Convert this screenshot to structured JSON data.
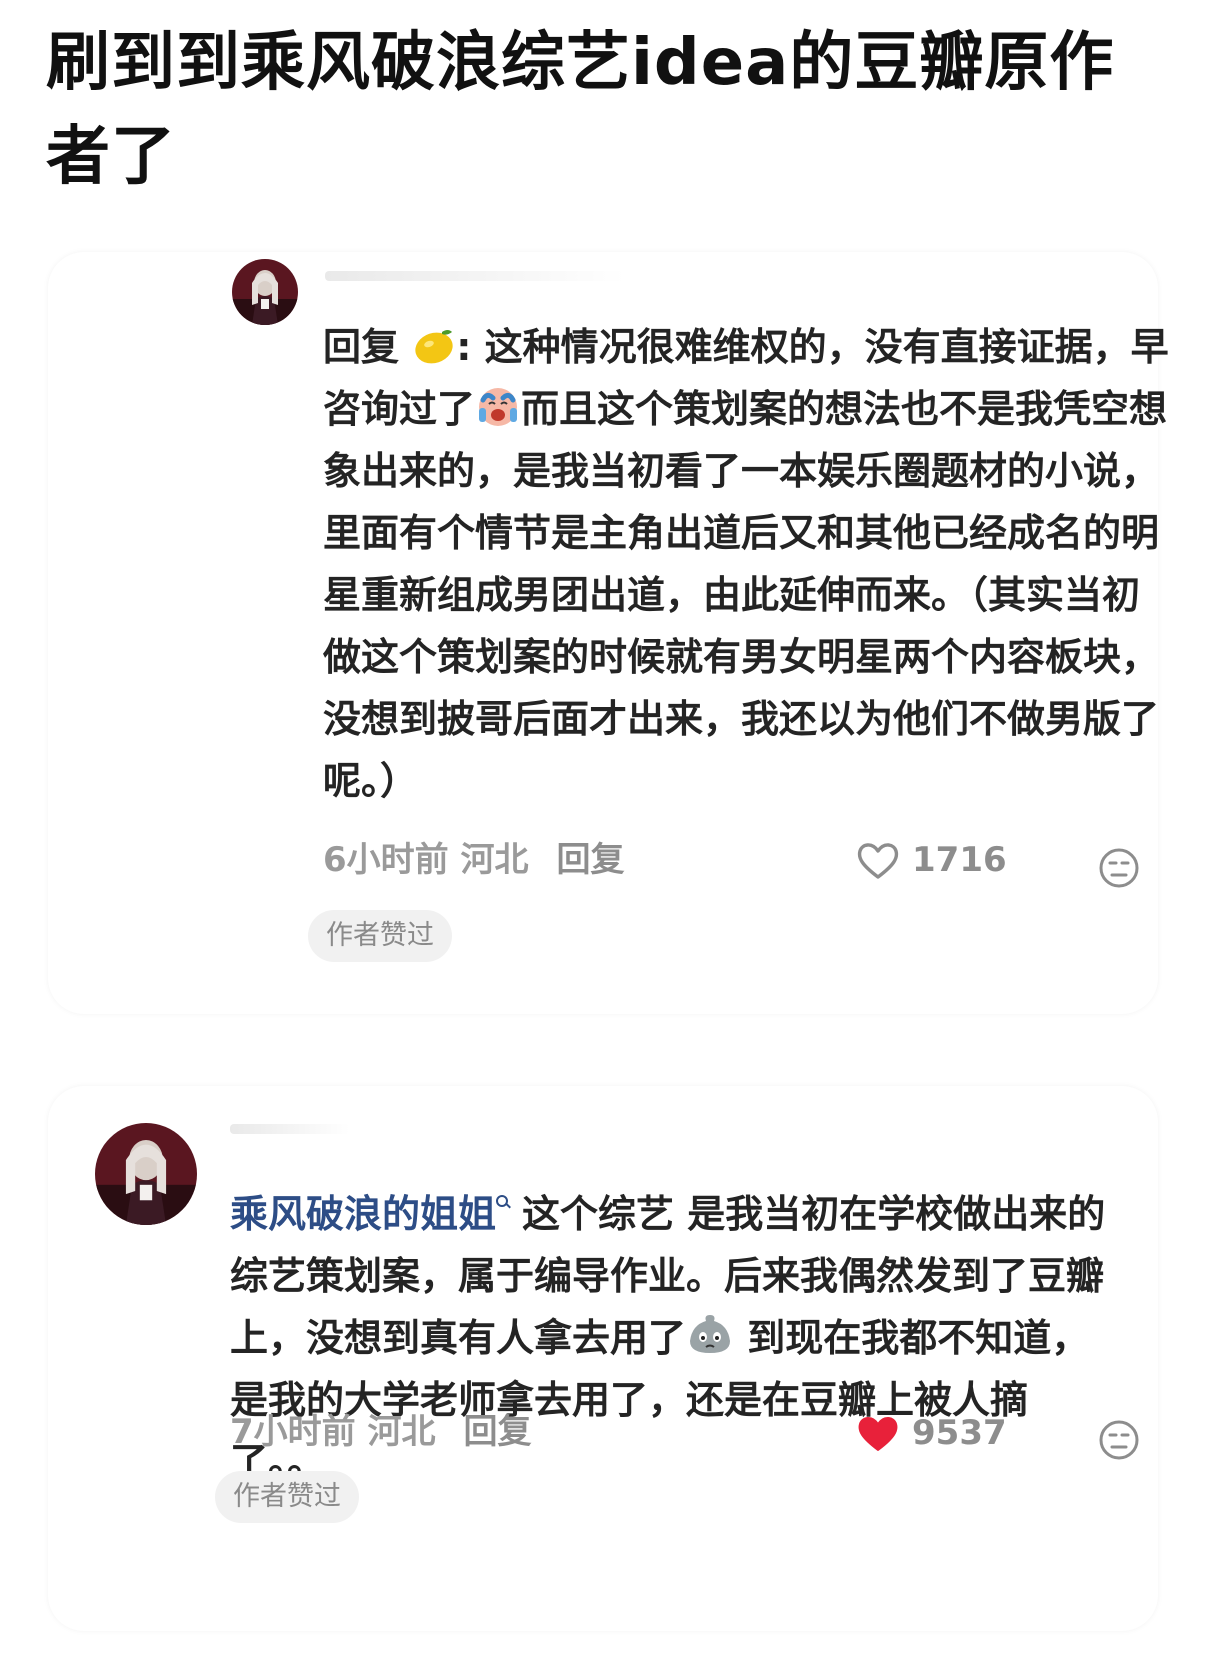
{
  "post": {
    "title": "刷到到乘风破浪综艺idea的豆瓣原作者了"
  },
  "comments": [
    {
      "reply_prefix": "回复 ",
      "text": ": 这种情况很难维权的，没有直接证据，早咨询过了",
      "text_after_emoji": "而且这个策划案的想法也不是我凭空想象出来的，是我当初看了一本娱乐圈题材的小说，里面有个情节是主角出道后又和其他已经成名的明星重新组成男团出道，由此延伸而来。（其实当初做这个策划案的时候就有男女明星两个内容板块，没想到披哥后面才出来，我还以为他们不做男版了呢。）",
      "time": "6小时前",
      "location": "河北",
      "reply_label": "回复",
      "likes": "1716",
      "liked": false,
      "badge": "作者赞过"
    },
    {
      "mention": "乘风破浪的姐姐",
      "text": "这个综艺 是我当初在学校做出来的综艺策划案，属于编导作业。后来我偶然发到了豆瓣上，没想到真有人拿去用了",
      "text_after_emoji": " 到现在我都不知道，是我的大学老师拿去用了，还是在豆瓣上被人摘了。。",
      "time": "7小时前",
      "location": "河北",
      "reply_label": "回复",
      "likes": "9537",
      "liked": true,
      "badge": "作者赞过"
    }
  ],
  "icons": {
    "reply_emoji": "lemon-emoji",
    "crying_emoji": "crying-face-emoji",
    "dumpling_emoji": "sad-dumpling-emoji",
    "like_outline": "heart-outline-icon",
    "like_filled": "heart-filled-icon",
    "face": "expressionless-face-icon"
  },
  "colors": {
    "mention": "#2d4d86",
    "meta_gray": "#9a9a9a",
    "like_red": "#e8213a",
    "badge_bg": "#f1f1f1"
  }
}
